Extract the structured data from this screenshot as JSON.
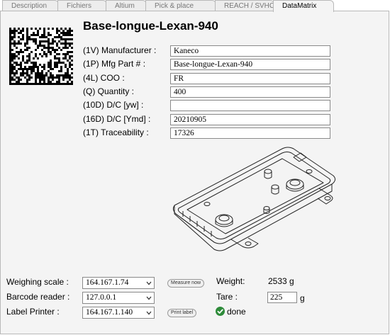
{
  "tabs": [
    {
      "label": "Description"
    },
    {
      "label": "Fichiers"
    },
    {
      "label": "Altium"
    },
    {
      "label": "Pick & place"
    },
    {
      "label": "REACH / SVHC"
    },
    {
      "label": "DataMatrix"
    }
  ],
  "active_tab": "DataMatrix",
  "part": {
    "title": "Base-longue-Lexan-940",
    "fields": [
      {
        "label": "(1V) Manufacturer :",
        "value": "Kaneco"
      },
      {
        "label": "(1P) Mfg Part # :",
        "value": "Base-longue-Lexan-940"
      },
      {
        "label": "(4L) COO :",
        "value": "FR"
      },
      {
        "label": "(Q) Quantity :",
        "value": "400"
      },
      {
        "label": "(10D) D/C [yw] :",
        "value": ""
      },
      {
        "label": "(16D) D/C [Ymd] :",
        "value": "20210905"
      },
      {
        "label": "(1T) Traceability :",
        "value": "17326"
      }
    ]
  },
  "devices": {
    "weighing_scale": {
      "label": "Weighing scale :",
      "value": "164.167.1.74"
    },
    "barcode_reader": {
      "label": "Barcode reader :",
      "value": "127.0.0.1"
    },
    "label_printer": {
      "label": "Label Printer :",
      "value": "164.167.1.140"
    },
    "measure_button": "Measure now",
    "print_button": "Print label"
  },
  "weighing": {
    "weight_label": "Weight:",
    "weight_value": "2533 g",
    "tare_label": "Tare :",
    "tare_value": "225",
    "tare_unit": "g",
    "status_text": "done",
    "status_color": "#2e8b3a"
  },
  "icons": {
    "datamatrix": "datamatrix-code",
    "part_drawing": "enclosure-line-drawing",
    "status": "check-circle-icon",
    "select_arrow": "chevron-down-icon"
  }
}
